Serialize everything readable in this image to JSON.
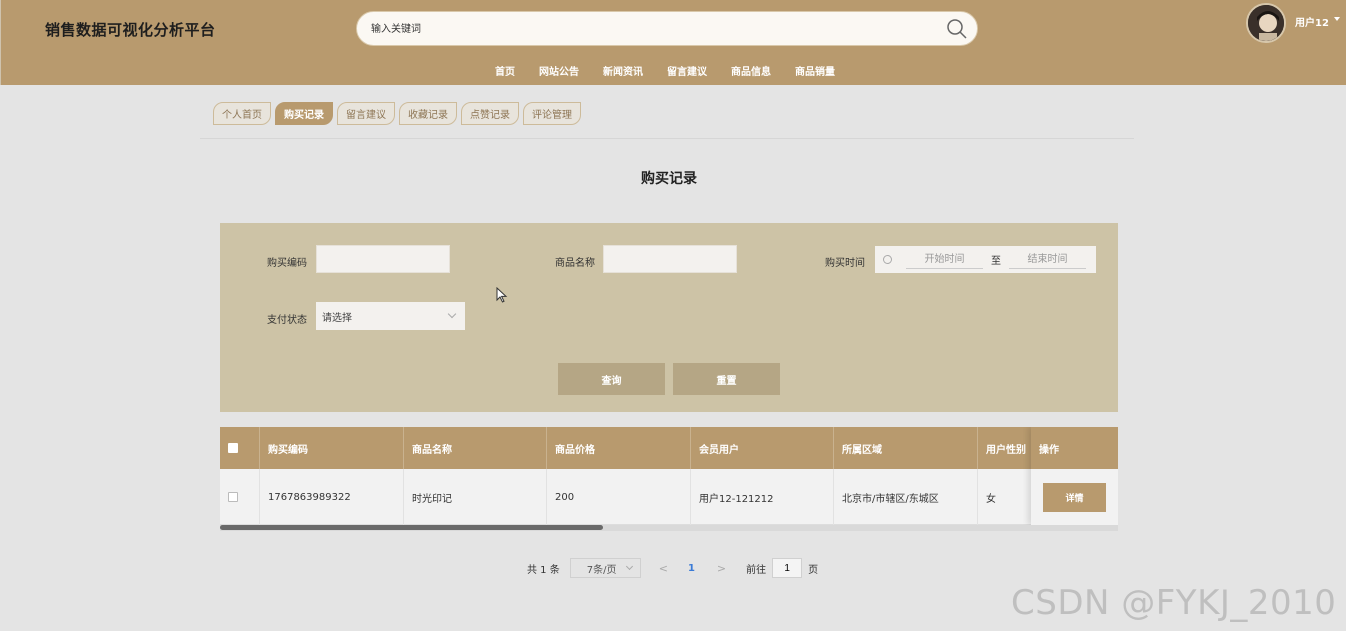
{
  "header": {
    "brand": "销售数据可视化分析平台",
    "search_placeholder": "输入关键词",
    "nav": [
      "首页",
      "网站公告",
      "新闻资讯",
      "留言建议",
      "商品信息",
      "商品销量"
    ],
    "user_name": "用户12"
  },
  "tabs": [
    {
      "label": "个人首页",
      "active": false
    },
    {
      "label": "购买记录",
      "active": true
    },
    {
      "label": "留言建议",
      "active": false
    },
    {
      "label": "收藏记录",
      "active": false
    },
    {
      "label": "点赞记录",
      "active": false
    },
    {
      "label": "评论管理",
      "active": false
    }
  ],
  "page_title": "购买记录",
  "filter": {
    "purchase_code_label": "购买编码",
    "product_name_label": "商品名称",
    "purchase_time_label": "购买时间",
    "start_placeholder": "开始时间",
    "range_sep": "至",
    "end_placeholder": "结束时间",
    "pay_status_label": "支付状态",
    "pay_status_value": "请选择",
    "query_button": "查询",
    "reset_button": "重置"
  },
  "table": {
    "columns": [
      "购买编码",
      "商品名称",
      "商品价格",
      "会员用户",
      "所属区域",
      "用户性别",
      "操作"
    ],
    "rows": [
      {
        "code": "1767863989322",
        "product": "时光印记",
        "price": "200",
        "member": "用户12-121212",
        "region": "北京市/市辖区/东城区",
        "gender": "女",
        "action": "详情"
      }
    ]
  },
  "pagination": {
    "total": "共 1 条",
    "page_size": "7条/页",
    "prev": "<",
    "current": "1",
    "next": ">",
    "goto_label": "前往",
    "goto_value": "1",
    "page_suffix": "页"
  },
  "watermark": "CSDN @FYKJ_2010",
  "colors": {
    "primary": "#b89a6e",
    "filter_bg": "#cdc3a6",
    "button": "#b5a685"
  }
}
